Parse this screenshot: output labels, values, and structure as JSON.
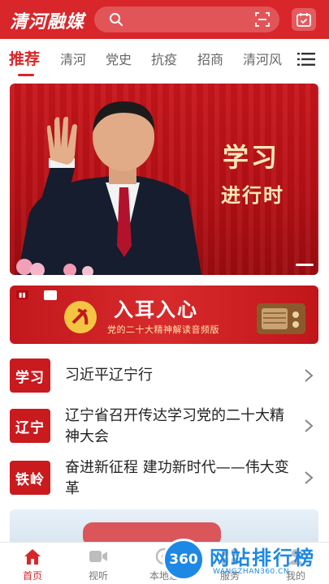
{
  "header": {
    "logo": "清河融媒",
    "search_placeholder": "",
    "colors": {
      "brand": "#d9262a"
    }
  },
  "tabs": [
    {
      "label": "推荐",
      "active": true
    },
    {
      "label": "清河"
    },
    {
      "label": "党史"
    },
    {
      "label": "抗疫"
    },
    {
      "label": "招商"
    },
    {
      "label": "清河风"
    }
  ],
  "banner": {
    "line1": "学习",
    "line2": "进行时"
  },
  "banner2": {
    "title": "入耳入心",
    "subtitle": "党的二十大精神解读音频版"
  },
  "list": [
    {
      "badge": "学习",
      "title": "习近平辽宁行"
    },
    {
      "badge": "辽宁",
      "title": "辽宁省召开传达学习党的二十大精神大会"
    },
    {
      "badge": "铁岭",
      "title": "奋进新征程 建功新时代——伟大变革"
    }
  ],
  "bottom_nav": [
    {
      "label": "首页",
      "icon": "home-icon",
      "active": true
    },
    {
      "label": "视听",
      "icon": "video-icon"
    },
    {
      "label": "本地通",
      "icon": "local-icon"
    },
    {
      "label": "服务",
      "icon": "service-icon"
    },
    {
      "label": "我的",
      "icon": "profile-icon"
    }
  ],
  "watermark": {
    "badge": "360",
    "text": "网站排行榜",
    "url": "WANGZHAN360.CN"
  }
}
